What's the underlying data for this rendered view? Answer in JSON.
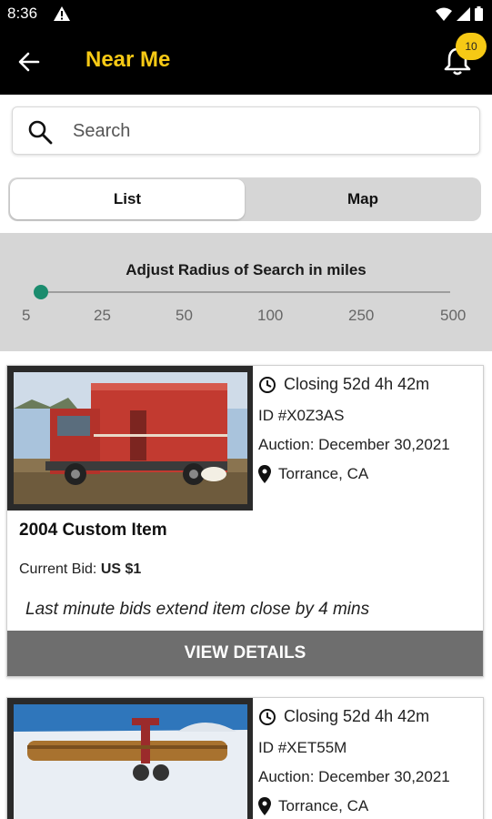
{
  "status_bar": {
    "time": "8:36"
  },
  "app_bar": {
    "title": "Near Me",
    "notification_count": "10"
  },
  "search": {
    "placeholder": "Search"
  },
  "view_toggle": {
    "list_label": "List",
    "map_label": "Map",
    "selected": "List"
  },
  "radius": {
    "title": "Adjust Radius of Search in miles",
    "ticks": [
      "5",
      "25",
      "50",
      "100",
      "250",
      "500"
    ],
    "selected": "5"
  },
  "listings": [
    {
      "closing": "Closing 52d 4h 42m",
      "id": "ID #X0Z3AS",
      "auction": "Auction: December 30,2021",
      "location": "Torrance, CA",
      "title": "2004 Custom Item",
      "bid_label": "Current Bid:",
      "bid_value": "US $1",
      "note": "Last minute bids extend item close by 4 mins",
      "button_label": "VIEW DETAILS",
      "image": "red-box-truck-photo"
    },
    {
      "closing": "Closing 52d 4h 42m",
      "id": "ID #XET55M",
      "auction": "Auction: December 30,2021",
      "location": "Torrance, CA",
      "image": "snow-equipment-photo"
    }
  ],
  "icons": {
    "back": "arrow-left-icon",
    "bell": "bell-icon",
    "search": "search-icon",
    "clock": "clock-icon",
    "location": "map-pin-icon"
  },
  "colors": {
    "accent": "#f6c915",
    "slider": "#1b8c6e",
    "button": "#6e6e6e",
    "panel": "#d6d6d6"
  }
}
